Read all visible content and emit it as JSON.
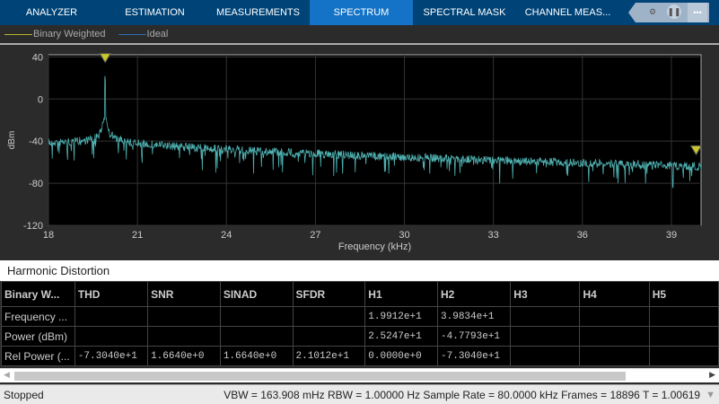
{
  "tabs": [
    "ANALYZER",
    "ESTIMATION",
    "MEASUREMENTS",
    "SPECTRUM",
    "SPECTRAL MASK",
    "CHANNEL MEAS..."
  ],
  "active_tab": "SPECTRUM",
  "legend": [
    {
      "label": "Binary Weighted",
      "color": "#b5b52a"
    },
    {
      "label": "Ideal",
      "color": "#2a6fb5"
    }
  ],
  "chart_data": {
    "type": "line",
    "xlabel": "Frequency (kHz)",
    "ylabel": "dBm",
    "xlim": [
      18,
      40
    ],
    "ylim": [
      -120,
      42
    ],
    "xticks": [
      "18",
      "21",
      "24",
      "27",
      "30",
      "33",
      "36",
      "39"
    ],
    "yticks": [
      "40",
      "0",
      "-40",
      "-80",
      "-120"
    ],
    "grid": true,
    "trace_color": "#4fb0b0",
    "markers": [
      {
        "x": 19.912,
        "y": 25.247
      },
      {
        "x": 39.834,
        "y": -47.793
      }
    ]
  },
  "section_title": "Harmonic Distortion",
  "table": {
    "header": [
      "Binary W...",
      "THD",
      "SNR",
      "SINAD",
      "SFDR",
      "H1",
      "H2",
      "H3",
      "H4",
      "H5"
    ],
    "rows": [
      [
        "Frequency ...",
        "",
        "",
        "",
        "",
        "1.9912e+1",
        "3.9834e+1",
        "",
        "",
        ""
      ],
      [
        "Power (dBm)",
        "",
        "",
        "",
        "",
        "2.5247e+1",
        "-4.7793e+1",
        "",
        "",
        ""
      ],
      [
        "Rel Power (...",
        "-7.3040e+1",
        "1.6640e+0",
        "1.6640e+0",
        "2.1012e+1",
        "0.0000e+0",
        "-7.3040e+1",
        "",
        "",
        ""
      ]
    ]
  },
  "status": {
    "state": "Stopped",
    "info": "VBW = 163.908 mHz  RBW = 1.00000 Hz  Sample Rate = 80.0000 kHz  Frames = 18896  T = 1.00619"
  }
}
